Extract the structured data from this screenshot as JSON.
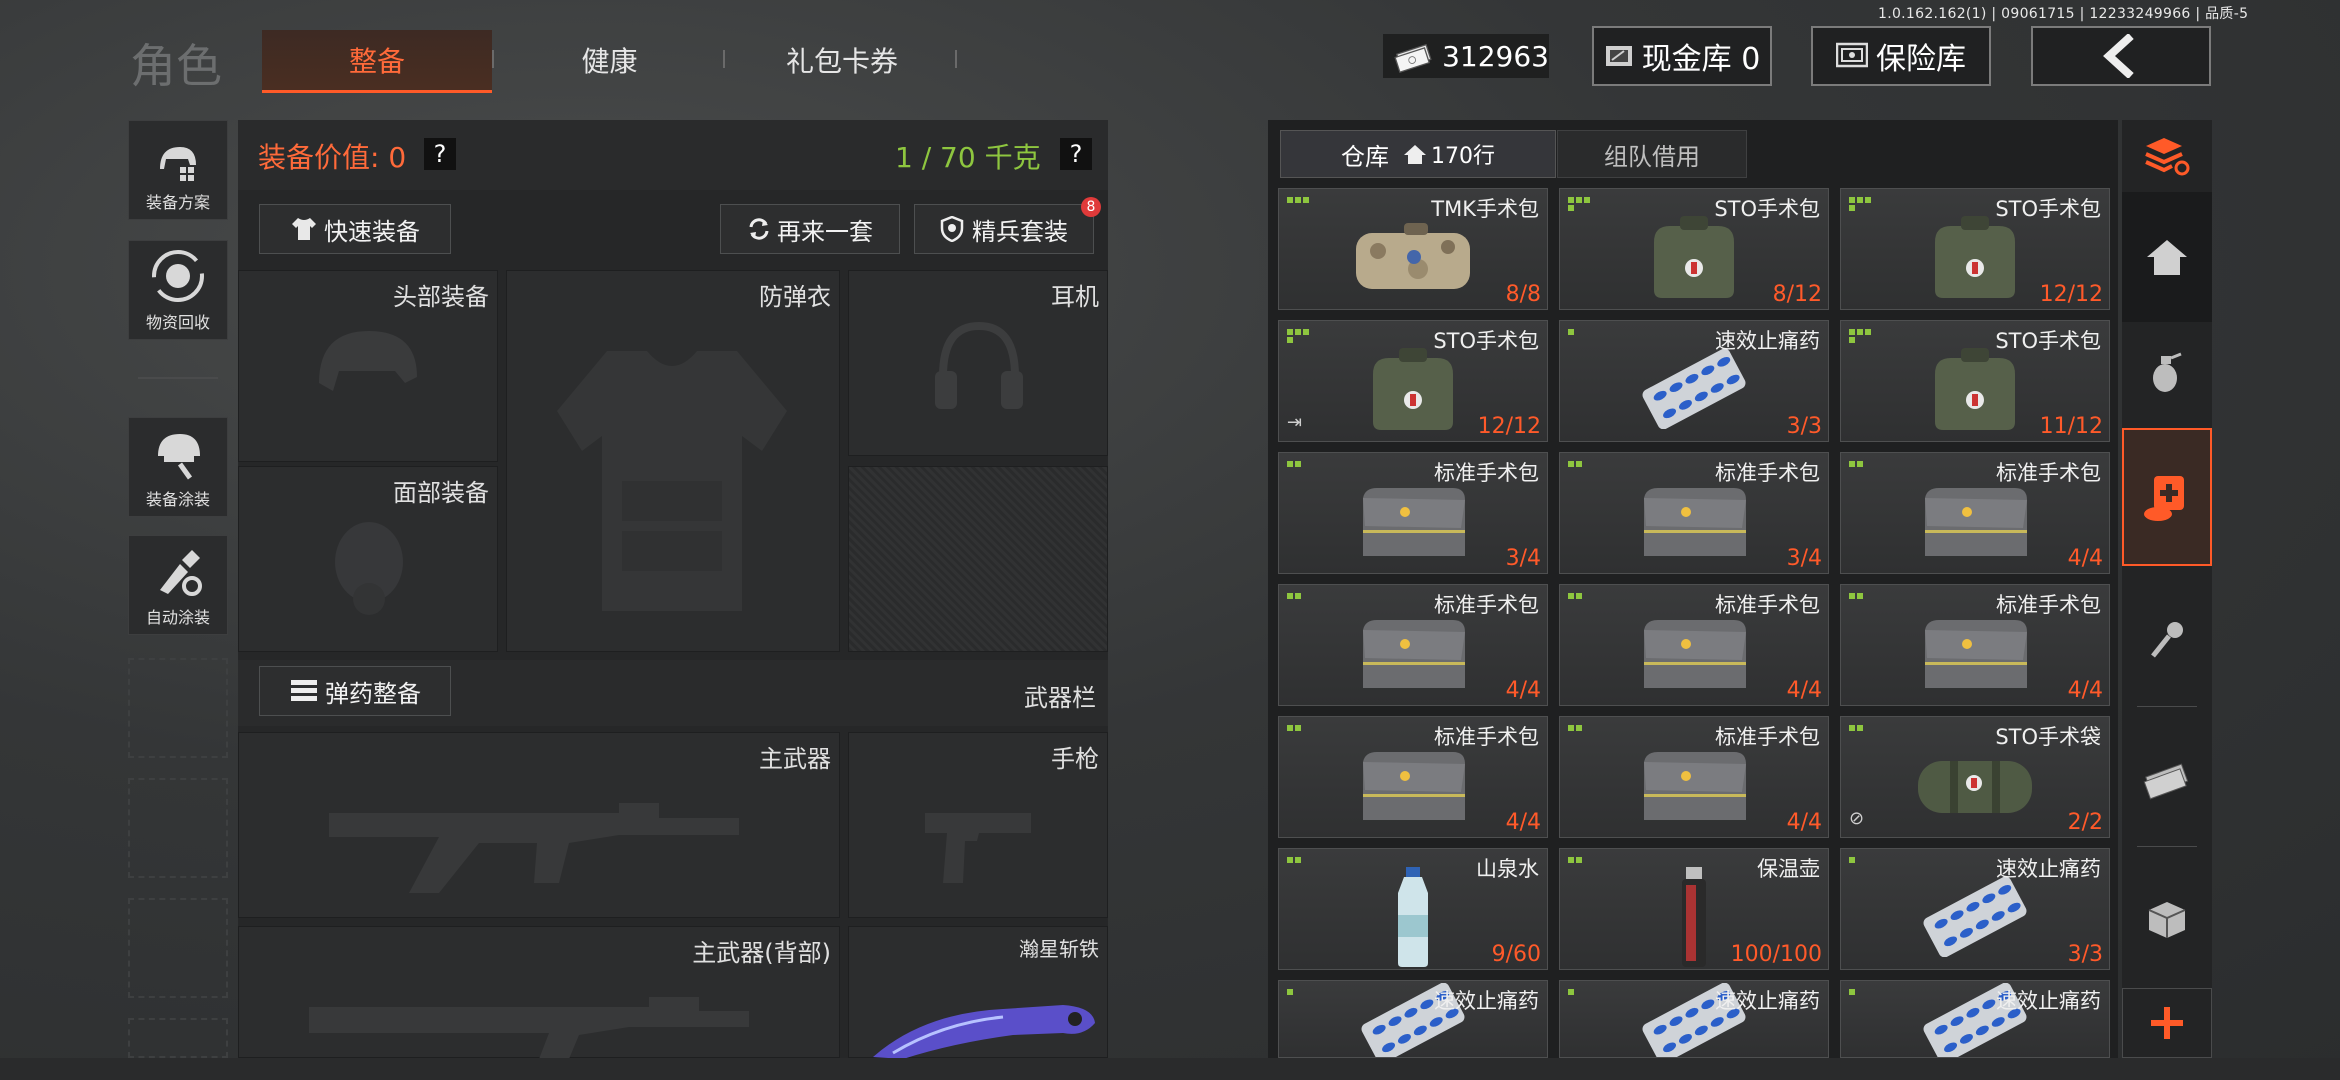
{
  "version": "1.0.162.162(1) | 09061715 | 12233249966 | 品质-5",
  "header": {
    "title": "角色",
    "tabs": [
      {
        "label": "整备",
        "active": true
      },
      {
        "label": "健康",
        "active": false
      },
      {
        "label": "礼包卡券",
        "active": false
      }
    ],
    "money": "312963",
    "cash_vault_label": "现金库 0",
    "insurance_label": "保险库",
    "back_icon": "chevron-left-icon"
  },
  "sidebar": {
    "items": [
      {
        "label": "装备方案",
        "icon": "loadout-icon"
      },
      {
        "label": "物资回收",
        "icon": "recycle-icon"
      },
      {
        "label": "装备涂装",
        "icon": "helmet-paint-icon"
      },
      {
        "label": "自动涂装",
        "icon": "auto-paint-icon"
      }
    ]
  },
  "equip": {
    "value_label": "装备价值: 0",
    "weight_label": "1 / 70 千克",
    "help": "?",
    "quick_equip": "快速装备",
    "again": "再来一套",
    "elite": "精兵套装",
    "elite_badge": "8",
    "slots": {
      "head": "头部装备",
      "armor": "防弹衣",
      "headset": "耳机",
      "face": "面部装备",
      "primary": "主武器",
      "pistol": "手枪",
      "primary_back": "主武器(背部)",
      "melee": "瀚星斩铁"
    },
    "ammo_btn": "弹药整备",
    "weapon_bar": "武器栏"
  },
  "storage": {
    "tab_storage": "仓库",
    "rows": "170行",
    "tab_team": "组队借用",
    "items": [
      {
        "name": "TMK手术包",
        "count": "8/8",
        "icon": "camo-surgery-kit",
        "dots": 3
      },
      {
        "name": "STO手术包",
        "count": "8/12",
        "icon": "green-surgery-kit",
        "dots": 4
      },
      {
        "name": "STO手术包",
        "count": "12/12",
        "icon": "green-surgery-kit",
        "dots": 4
      },
      {
        "name": "STO手术包",
        "count": "12/12",
        "icon": "green-surgery-kit",
        "dots": 4,
        "corner": "⇥"
      },
      {
        "name": "速效止痛药",
        "count": "3/3",
        "icon": "pill-blister",
        "dots": 1
      },
      {
        "name": "STO手术包",
        "count": "11/12",
        "icon": "green-surgery-kit",
        "dots": 4
      },
      {
        "name": "标准手术包",
        "count": "3/4",
        "icon": "grey-medbag",
        "dots": 2
      },
      {
        "name": "标准手术包",
        "count": "3/4",
        "icon": "grey-medbag",
        "dots": 2
      },
      {
        "name": "标准手术包",
        "count": "4/4",
        "icon": "grey-medbag",
        "dots": 2
      },
      {
        "name": "标准手术包",
        "count": "4/4",
        "icon": "grey-medbag",
        "dots": 2
      },
      {
        "name": "标准手术包",
        "count": "4/4",
        "icon": "grey-medbag",
        "dots": 2
      },
      {
        "name": "标准手术包",
        "count": "4/4",
        "icon": "grey-medbag",
        "dots": 2
      },
      {
        "name": "标准手术包",
        "count": "4/4",
        "icon": "grey-medbag",
        "dots": 2
      },
      {
        "name": "标准手术包",
        "count": "4/4",
        "icon": "grey-medbag",
        "dots": 2
      },
      {
        "name": "STO手术袋",
        "count": "2/2",
        "icon": "green-roll-bag",
        "dots": 2,
        "corner": "⊘"
      },
      {
        "name": "山泉水",
        "count": "9/60",
        "icon": "water-bottle",
        "dots": 2
      },
      {
        "name": "保温壶",
        "count": "100/100",
        "icon": "thermos",
        "dots": 2
      },
      {
        "name": "速效止痛药",
        "count": "3/3",
        "icon": "pill-blister",
        "dots": 1
      },
      {
        "name": "速效止痛药",
        "count": "",
        "icon": "pill-blister",
        "dots": 1
      },
      {
        "name": "速效止痛药",
        "count": "",
        "icon": "pill-blister",
        "dots": 1
      },
      {
        "name": "速效止痛药",
        "count": "",
        "icon": "pill-blister",
        "dots": 1
      }
    ]
  },
  "rail": {
    "icons": [
      "sort-stack-icon",
      "home-icon",
      "grenade-icon",
      "medical-icon",
      "key-icon",
      "cash-icon",
      "box-icon",
      "plus-icon"
    ],
    "active_index": 3
  },
  "colors": {
    "accent": "#ff5a28",
    "good": "#8ec63f",
    "count": "#ff5a2a"
  }
}
